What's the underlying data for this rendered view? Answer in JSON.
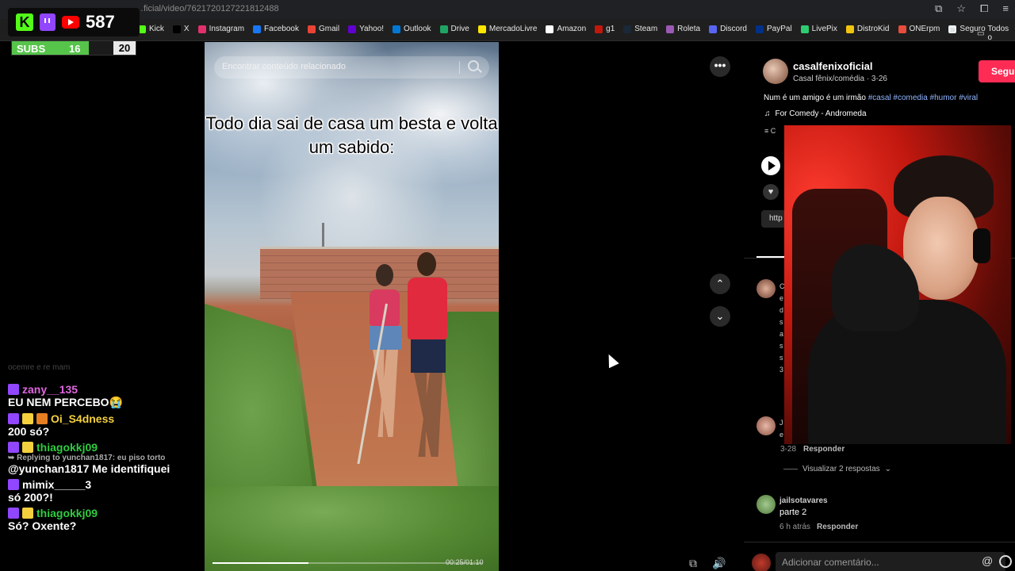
{
  "browser": {
    "url": "…ficial/video/7621720127221812488",
    "bookmarks": [
      {
        "label": "Kick",
        "color": "#53fc18"
      },
      {
        "label": "X",
        "color": "#000000"
      },
      {
        "label": "Instagram",
        "color": "#e1306c"
      },
      {
        "label": "Facebook",
        "color": "#1877f2"
      },
      {
        "label": "Gmail",
        "color": "#ea4335"
      },
      {
        "label": "Yahoo!",
        "color": "#6001d2"
      },
      {
        "label": "Outlook",
        "color": "#0078d4"
      },
      {
        "label": "Drive",
        "color": "#1fa463"
      },
      {
        "label": "MercadoLivre",
        "color": "#ffe600"
      },
      {
        "label": "Amazon",
        "color": "#ffffff"
      },
      {
        "label": "g1",
        "color": "#c4170c"
      },
      {
        "label": "Steam",
        "color": "#1b2838"
      },
      {
        "label": "Roleta",
        "color": "#9b59b6"
      },
      {
        "label": "Discord",
        "color": "#5865f2"
      },
      {
        "label": "PayPal",
        "color": "#003087"
      },
      {
        "label": "LivePix",
        "color": "#2ecc71"
      },
      {
        "label": "DistroKid",
        "color": "#f1c40f"
      },
      {
        "label": "ONErpm",
        "color": "#e74c3c"
      },
      {
        "label": "Seguro",
        "color": "#ecf0f1"
      }
    ],
    "more_label": "»",
    "folder_label": "Todos o"
  },
  "overlay": {
    "viewer_count": "587",
    "subs_label": "SUBS",
    "subs_current": "16",
    "subs_goal": "20",
    "subs_progress": 0.8
  },
  "chat": {
    "faded_line": "ocemre e re mam",
    "messages": [
      {
        "user": "zany__135",
        "color": "#e066e0",
        "badges": [
          "tw"
        ],
        "text": "EU NEM PERCEBO😭"
      },
      {
        "user": "Oi_S4dness",
        "color": "#f4d03f",
        "badges": [
          "tw",
          "sub",
          "mod"
        ],
        "text": "200 só?"
      },
      {
        "user": "thiagokkj09",
        "color": "#2ecc40",
        "badges": [
          "tw",
          "sub"
        ],
        "reply": "➥ Replying to yunchan1817: eu piso torto",
        "text": "@yunchan1817 Me identifiquei"
      },
      {
        "user": "mimix_____3",
        "color": "#ffffff",
        "badges": [
          "tw"
        ],
        "text": "só 200?!"
      },
      {
        "user": "thiagokkj09",
        "color": "#2ecc40",
        "badges": [
          "tw",
          "sub"
        ],
        "text": "Só? Oxente?"
      }
    ]
  },
  "video": {
    "search_placeholder": "Encontrar conteúdo relacionado",
    "caption": "Todo dia sai de casa um besta e volta um sabido:",
    "time": "00:25/01:10",
    "progress": 0.357
  },
  "controls": {
    "more_icon": "•••",
    "up_icon": "⌃",
    "down_icon": "⌄",
    "pip_icon": "⧉",
    "volume_icon": "🔊"
  },
  "post": {
    "username": "casalfenixoficial",
    "subline": "Casal fênix/comédia · 3-26",
    "follow_label": "Segui",
    "desc_text": "Num é um amigo é um irmão ",
    "tags": [
      "#casal",
      "#comedia",
      "#humor",
      "#viral"
    ],
    "music": "For Comedy - Andromeda",
    "partial_text": "C",
    "link_text": "http"
  },
  "comments": [
    {
      "snip": [
        "C",
        "e",
        "d",
        "s",
        "a",
        "s",
        "s",
        "3"
      ]
    },
    {
      "snip": [
        "J",
        "e"
      ],
      "date": "3-28",
      "reply": "Responder",
      "view_replies": "Visualizar 2 respostas"
    },
    {
      "user": "jailsotavares",
      "text": "parte 2",
      "date": "6 h atrás",
      "reply": "Responder"
    }
  ],
  "comment_input": {
    "placeholder": "Adicionar comentário...",
    "at_icon": "@"
  }
}
